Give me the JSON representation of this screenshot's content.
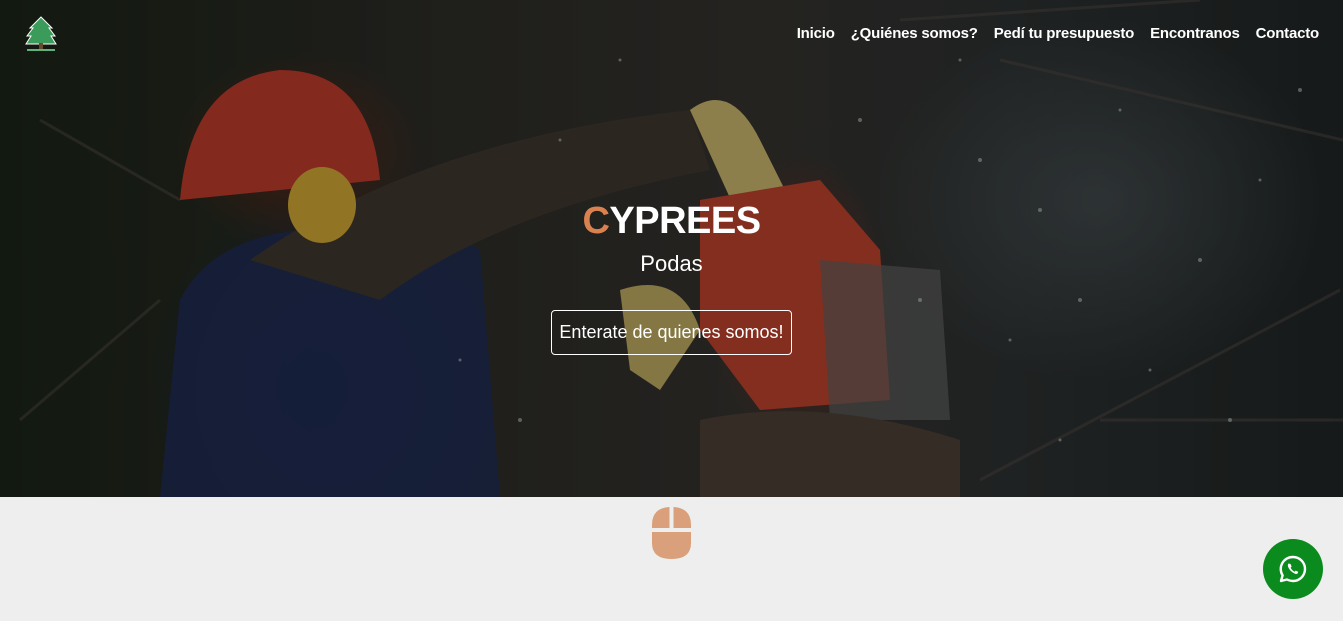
{
  "header": {
    "logo_icon": "cypress-tree-logo-icon",
    "nav": [
      {
        "label": "Inicio"
      },
      {
        "label": "¿Quiénes somos?"
      },
      {
        "label": "Pedí tu presupuesto"
      },
      {
        "label": "Encontranos"
      },
      {
        "label": "Contacto"
      }
    ]
  },
  "hero": {
    "brand_first_letter": "C",
    "brand_rest": "YPREES",
    "subtitle": "Podas",
    "cta_label": "Enterate de quienes somos!"
  },
  "scroll_indicator": {
    "icon": "mouse-icon",
    "color": "#d9a07b"
  },
  "whatsapp": {
    "icon": "whatsapp-icon",
    "color": "#0b8b1e"
  },
  "colors": {
    "accent": "#d9824f",
    "page_background": "#eeeeee"
  }
}
